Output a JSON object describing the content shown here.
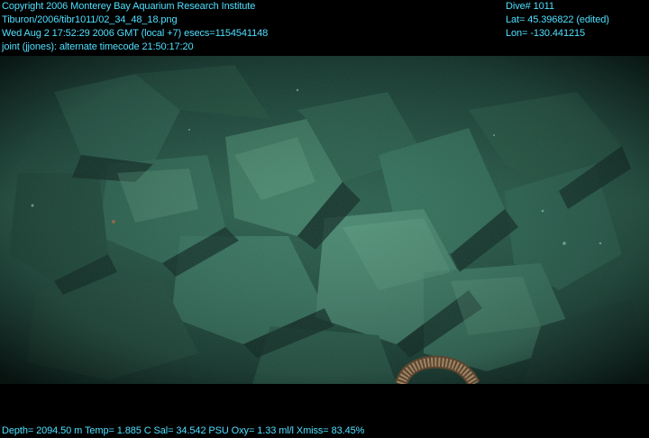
{
  "header_left": {
    "line1": "Copyright 2006 Monterey Bay Aquarium Research Institute",
    "line2": "Tiburon/2006/tibr1011/02_34_48_18.png",
    "line3": "Wed Aug  2 17:52:29 2006 GMT (local +7)  esecs=1154541148",
    "line4": "joint (jjones): alternate timecode 21:50:17:20"
  },
  "header_right": {
    "dive": "Dive# 1011",
    "lat": "Lat= 45.396822 (edited)",
    "lon": "Lon= -130.441215"
  },
  "footer": {
    "telemetry": "Depth= 2094.50 m  Temp= 1.885 C  Sal= 34.542 PSU  Oxy= 1.33 ml/l  Xmiss= 83.45%"
  },
  "colors": {
    "overlay_text": "#4fe0ff",
    "seafloor_base": "#1e4a3e",
    "seafloor_light": "#4e8a72",
    "shadow": "#0b1c18"
  }
}
